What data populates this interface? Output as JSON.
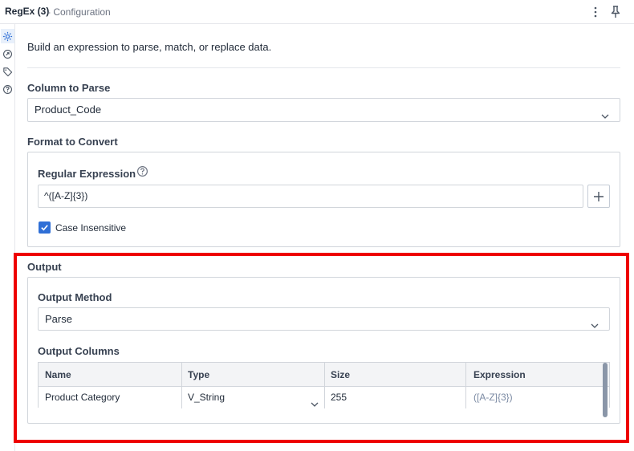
{
  "header": {
    "title": "RegEx (3)",
    "subtitle": "- Configuration"
  },
  "rail": {
    "items": [
      "configuration-gear-icon",
      "annotation-icon",
      "tag-icon",
      "help-icon"
    ]
  },
  "description": "Build an expression to parse, match, or replace data.",
  "column_to_parse": {
    "label": "Column to Parse",
    "value": "Product_Code"
  },
  "format_to_convert": {
    "label": "Format to Convert",
    "regex_label": "Regular Expression",
    "regex_value": "^([A-Z]{3})",
    "case_insensitive_label": "Case Insensitive",
    "case_insensitive_checked": true
  },
  "output": {
    "label": "Output",
    "method_label": "Output Method",
    "method_value": "Parse",
    "columns_label": "Output Columns",
    "table": {
      "headers": [
        "Name",
        "Type",
        "Size",
        "Expression"
      ],
      "rows": [
        {
          "name": "Product Category",
          "type": "V_String",
          "size": "255",
          "expression": "([A-Z]{3})"
        }
      ]
    }
  },
  "colors": {
    "accent": "#2f6fd6",
    "highlight": "#ee0000",
    "expression_text": "#7b8aa3"
  }
}
